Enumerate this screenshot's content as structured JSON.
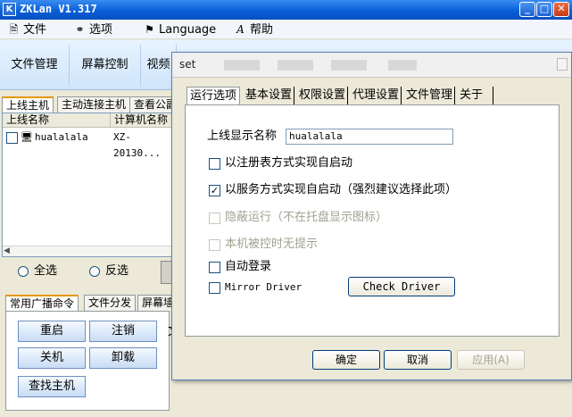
{
  "window": {
    "title": "ZKLan V1.317",
    "icon_glyph": "K"
  },
  "menubar": [
    {
      "label": "文件",
      "icon": "file-icon"
    },
    {
      "label": "选项",
      "icon": "options-icon"
    },
    {
      "label": "Language",
      "icon": "language-icon"
    },
    {
      "label": "帮助",
      "icon": "help-icon"
    }
  ],
  "toolbar": [
    "文件管理",
    "屏幕控制",
    "视频"
  ],
  "host_tabs": [
    "上线主机",
    "主动连接主机",
    "查看公副"
  ],
  "host_list": {
    "columns": [
      "上线名称",
      "计算机名称"
    ],
    "rows": [
      {
        "name": "hualalala",
        "computer": "XZ-20130..."
      }
    ]
  },
  "radios": [
    "全选",
    "反选"
  ],
  "cmd_tabs": [
    "常用广播命令",
    "文件分发",
    "屏幕墙"
  ],
  "cmd_buttons": [
    "重启",
    "注销",
    "关机",
    "卸载",
    "查找主机"
  ],
  "side_text": "文",
  "dialog": {
    "title": "set",
    "tabs": [
      "运行选项",
      "基本设置",
      "权限设置",
      "代理设置",
      "文件管理",
      "关于"
    ],
    "online_name_label": "上线显示名称",
    "online_name_value": "hualalala",
    "options": [
      {
        "label": "以注册表方式实现自启动",
        "checked": false,
        "disabled": false
      },
      {
        "label": "以服务方式实现自启动（强烈建议选择此项）",
        "checked": true,
        "disabled": false
      },
      {
        "label": "隐蔽运行（不在托盘显示图标）",
        "checked": false,
        "disabled": true
      },
      {
        "label": "本机被控时无提示",
        "checked": false,
        "disabled": true
      },
      {
        "label": "自动登录",
        "checked": false,
        "disabled": false
      },
      {
        "label": "Mirror Driver",
        "checked": false,
        "disabled": false
      }
    ],
    "check_driver": "Check Driver",
    "ok": "确定",
    "cancel": "取消",
    "apply": "应用(A)"
  },
  "colors": {
    "title_blue": "#0a5fd8",
    "accent_orange": "#e59700"
  }
}
